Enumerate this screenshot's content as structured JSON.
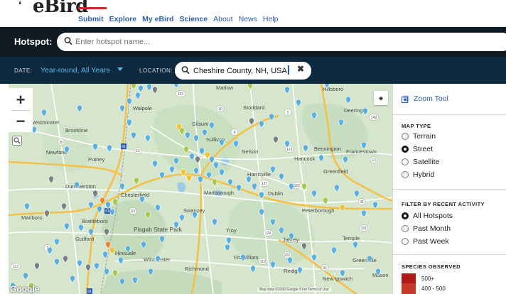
{
  "nav": {
    "logo": "eBird",
    "links": [
      "Submit",
      "Explore",
      "My eBird",
      "Science",
      "About",
      "News",
      "Help"
    ]
  },
  "hotspot": {
    "label": "Hotspot:",
    "placeholder": "Enter hotspot name..."
  },
  "filters": {
    "date_label": "DATE:",
    "date_value": "Year-round, All Years",
    "location_label": "LOCATION:",
    "location_value": "Cheshire County, NH, USA"
  },
  "map": {
    "attribution": "Map data ©2020 Google   5 km    Terms of Use",
    "provider": "Google",
    "place_labels": [
      "Marlow",
      "Hillsboro",
      "Walpole",
      "Stoddard",
      "Deering",
      "Gilsum",
      "Westminster",
      "Brookline",
      "Sullivan",
      "Newfane",
      "Putney",
      "Nelson",
      "Bennington",
      "Francestown",
      "Hancock",
      "Harrisville",
      "Greenfield",
      "Dummerston",
      "Chesterfield",
      "Marlborough",
      "Dublin",
      "Swanzey",
      "Peterborough",
      "Marlboro",
      "Brattleboro",
      "Troy",
      "Jaffrey",
      "Temple",
      "Guilford",
      "Pisgah State Park",
      "Hinsdale",
      "Winchester",
      "Richmond",
      "Fitzwilliam",
      "Rindge",
      "Greenville",
      "New Ipswich",
      "Mason"
    ],
    "colors": {
      "land": "#d5e6cd",
      "highway": "#f5c04a",
      "marker_blue": "#5aaee0",
      "marker_green": "#a9c64d",
      "marker_gray": "#7a7f86"
    }
  },
  "sidebar": {
    "zoom_tool": "Zoom Tool",
    "map_type_title": "MAP TYPE",
    "map_types": [
      "Terrain",
      "Street",
      "Satellite",
      "Hybrid"
    ],
    "map_type_selected": "Street",
    "activity_title": "FILTER BY RECENT ACTIVITY",
    "activity_options": [
      "All Hotspots",
      "Past Month",
      "Past Week"
    ],
    "activity_selected": "All Hotspots",
    "species_title": "SPECIES OBSERVED",
    "species_legend": [
      {
        "label": "500+",
        "color": "#b01818"
      },
      {
        "label": "400 - 500",
        "color": "#c73a2a"
      }
    ]
  }
}
